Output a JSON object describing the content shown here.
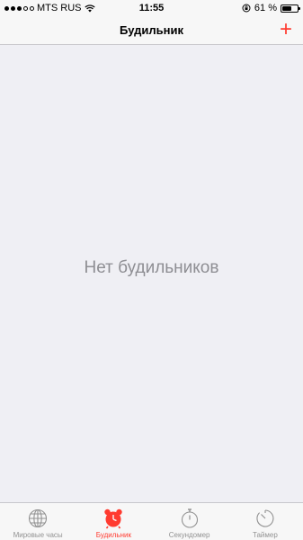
{
  "status_bar": {
    "carrier": "MTS RUS",
    "time": "11:55",
    "battery_text": "61 %",
    "battery_level": 0.61,
    "signal_dots": 3
  },
  "nav": {
    "title": "Будильник",
    "add_label": "+"
  },
  "main": {
    "empty_message": "Нет будильников"
  },
  "tabs": [
    {
      "label": "Мировые часы",
      "icon": "globe-icon",
      "active": false
    },
    {
      "label": "Будильник",
      "icon": "alarm-clock-icon",
      "active": true
    },
    {
      "label": "Секундомер",
      "icon": "stopwatch-icon",
      "active": false
    },
    {
      "label": "Таймер",
      "icon": "timer-icon",
      "active": false
    }
  ],
  "colors": {
    "accent": "#ff3b30",
    "inactive": "#929292",
    "background": "#efeff4",
    "bar": "#f7f7f7"
  }
}
